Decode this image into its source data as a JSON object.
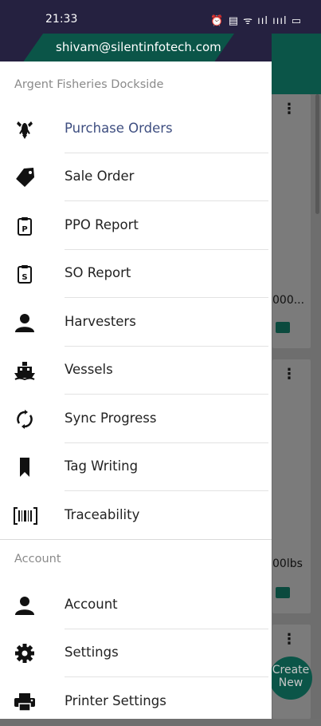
{
  "status_bar": {
    "time": "21:33",
    "icons": "⏰ ▤ ᯤ ııl ıııl ▭"
  },
  "drawer": {
    "email": "shivam@silentinfotech.com",
    "organization": "Argent Fisheries Dockside",
    "menu_items": [
      {
        "label": "Purchase Orders",
        "icon": "lobster-icon",
        "active": true
      },
      {
        "label": "Sale Order",
        "icon": "tag-icon"
      },
      {
        "label": "PPO Report",
        "icon": "clipboard-p-icon"
      },
      {
        "label": "SO Report",
        "icon": "clipboard-s-icon"
      },
      {
        "label": "Harvesters",
        "icon": "person-icon"
      },
      {
        "label": "Vessels",
        "icon": "boat-icon"
      },
      {
        "label": "Sync Progress",
        "icon": "sync-icon"
      },
      {
        "label": "Tag Writing",
        "icon": "bookmark-icon"
      },
      {
        "label": "Traceability",
        "icon": "barcode-icon"
      }
    ],
    "account_section_label": "Account",
    "account_items": [
      {
        "label": "Account",
        "icon": "person-icon"
      },
      {
        "label": "Settings",
        "icon": "gear-icon"
      },
      {
        "label": "Printer Settings",
        "icon": "printer-icon"
      }
    ]
  },
  "background": {
    "card1_text": "000...",
    "card2_text": "00lbs",
    "fab_label_line1": "Create",
    "fab_label_line2": "New"
  },
  "colors": {
    "header_dark": "#252140",
    "accent_green": "#0b5548",
    "active_label": "#3e4e80"
  }
}
